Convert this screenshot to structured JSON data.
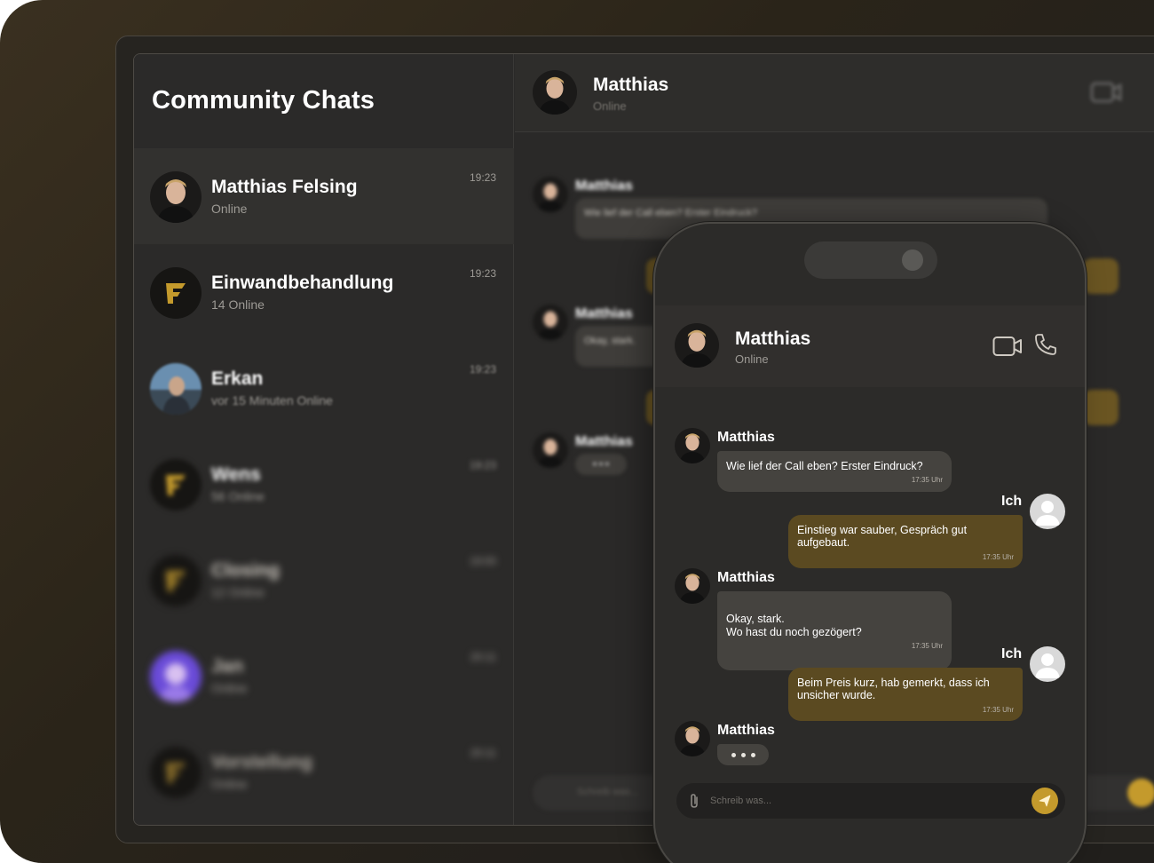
{
  "sidebar": {
    "title": "Community Chats",
    "items": [
      {
        "name": "Matthias Felsing",
        "status": "Online",
        "time": "19:23"
      },
      {
        "name": "Einwandbehandlung",
        "status": "14 Online",
        "time": "19:23"
      },
      {
        "name": "Erkan",
        "status": "vor 15 Minuten Online",
        "time": "19:23"
      },
      {
        "name": "Wens",
        "status": "56 Online",
        "time": "19:23"
      },
      {
        "name": "Closing",
        "status": "12 Online",
        "time": "19:00"
      },
      {
        "name": "Jan",
        "status": "Online",
        "time": "20:11"
      },
      {
        "name": "Vorstellung",
        "status": "Online",
        "time": "20:11"
      }
    ]
  },
  "desktop_chat": {
    "contact_name": "Matthias",
    "contact_status": "Online",
    "messages": [
      {
        "sender": "Matthias",
        "text": "Wie lief der Call eben? Erster Eindruck?"
      },
      {
        "sender": "Matthias",
        "text": "Okay, stark."
      },
      {
        "sender": "Matthias",
        "text": "• • •"
      }
    ],
    "composer_placeholder": "Schreib was..."
  },
  "phone_chat": {
    "contact_name": "Matthias",
    "contact_status": "Online",
    "messages": [
      {
        "sender": "Matthias",
        "text": "Wie lief der Call eben? Erster Eindruck?",
        "time": "17:35 Uhr",
        "direction": "in"
      },
      {
        "sender": "Ich",
        "text": "Einstieg war sauber, Gespräch gut aufgebaut.",
        "time": "17:35 Uhr",
        "direction": "out"
      },
      {
        "sender": "Matthias",
        "text": "Okay, stark.\nWo hast du noch gezögert?",
        "time": "17:35 Uhr",
        "direction": "in"
      },
      {
        "sender": "Ich",
        "text": "Beim Preis kurz, hab gemerkt, dass ich unsicher wurde.",
        "time": "17:35 Uhr",
        "direction": "out"
      },
      {
        "sender": "Matthias",
        "typing": true,
        "direction": "in"
      }
    ],
    "composer_placeholder": "Schreib was..."
  },
  "colors": {
    "accent": "#c49a2c",
    "outgoing_bubble": "#5b4a21",
    "incoming_bubble": "#45433f"
  }
}
